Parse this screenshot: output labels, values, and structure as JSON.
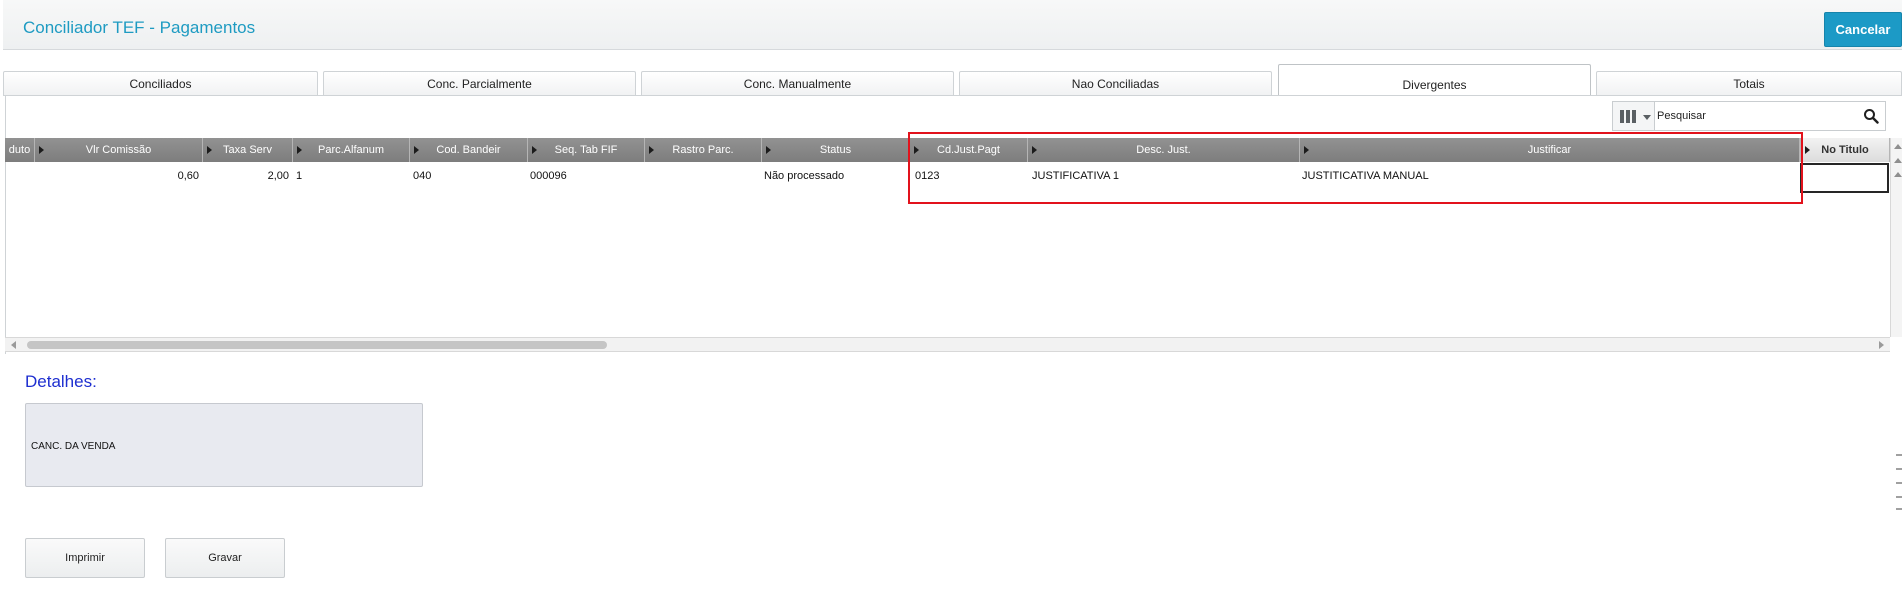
{
  "header": {
    "title": "Conciliador TEF - Pagamentos",
    "cancel_label": "Cancelar"
  },
  "tabs": [
    {
      "label": "Conciliados",
      "active": false
    },
    {
      "label": "Conc. Parcialmente",
      "active": false
    },
    {
      "label": "Conc. Manualmente",
      "active": false
    },
    {
      "label": "Nao Conciliadas",
      "active": false
    },
    {
      "label": "Divergentes",
      "active": true
    },
    {
      "label": "Totais",
      "active": false
    }
  ],
  "search": {
    "placeholder": "Pesquisar",
    "icons": {
      "columns": "columns-icon",
      "search": "search-icon"
    }
  },
  "grid": {
    "columns": [
      "duto",
      "Vlr Comissão",
      "Taxa Serv",
      "Parc.Alfanum",
      "Cod. Bandeir",
      "Seq. Tab FIF",
      "Rastro Parc.",
      "Status",
      "Cd.Just.Pagt",
      "Desc. Just.",
      "Justificar",
      "No Titulo"
    ],
    "rows": [
      [
        "",
        "0,60",
        "2,00",
        "1",
        "040",
        "000096",
        "",
        "Não processado",
        "0123",
        "JUSTIFICATIVA 1",
        "JUSTITICATIVA MANUAL",
        ""
      ]
    ]
  },
  "details": {
    "label": "Detalhes:",
    "value": "CANC. DA VENDA"
  },
  "actions": {
    "print_label": "Imprimir",
    "save_label": "Gravar"
  },
  "colors": {
    "accent": "#1e9bc2",
    "cancel_button": "#1c9ac6",
    "details_label": "#1e2fd0",
    "highlight_border": "#e2121c",
    "column_header": "#868686"
  }
}
